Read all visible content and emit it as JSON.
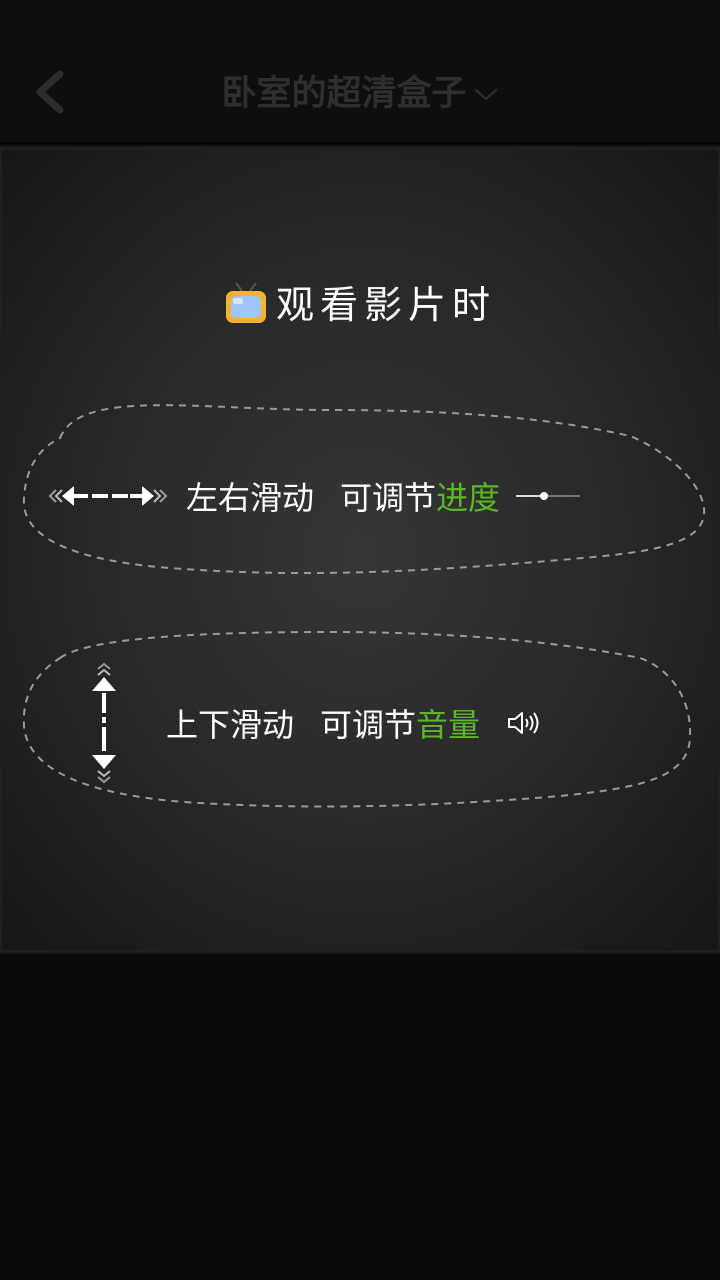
{
  "header": {
    "title": "卧室的超清盒子",
    "back_icon": "chevron-left-icon",
    "dropdown_icon": "chevron-down-icon"
  },
  "guide": {
    "heading": "观看影片时",
    "heading_icon": "tv-icon",
    "horizontal": {
      "prefix": "左右滑动",
      "middle": "可调节",
      "highlight": "进度",
      "gesture_icon": "horizontal-arrows-icon",
      "end_icon": "progress-slider-icon"
    },
    "vertical": {
      "prefix": "上下滑动",
      "middle": "可调节",
      "highlight": "音量",
      "gesture_icon": "vertical-arrows-icon",
      "end_icon": "speaker-icon"
    }
  },
  "colors": {
    "accent": "#5bb62a",
    "background": "#0b0b0b",
    "panel": "#2a2a2a",
    "title": "#2e2e2e",
    "text": "#ffffff"
  }
}
